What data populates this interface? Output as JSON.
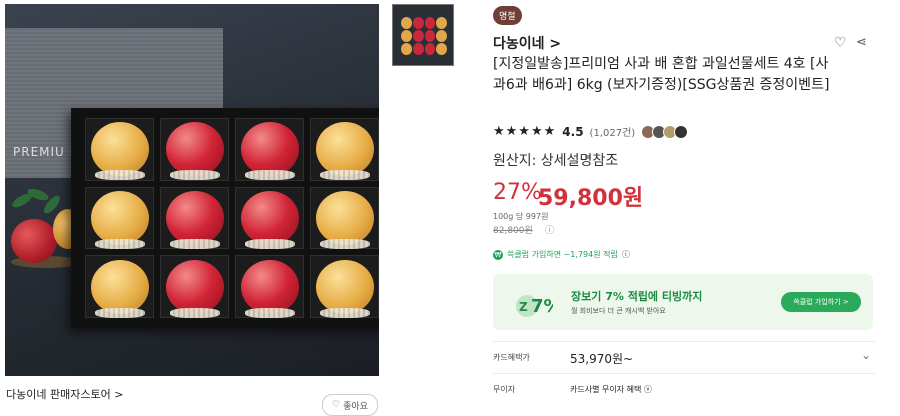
{
  "header": {
    "badge": "명절",
    "brand": "다농이네 >"
  },
  "image": {
    "panel_text": "PREMIU M"
  },
  "product": {
    "title": "[지정일발송]프리미엄 사과 배 혼합 과일선물세트 4호 [사과6과 배6과] 6kg (보자기증정)[SSG상품권 증정이벤트]",
    "stars": "★★★★★",
    "rating": "4.5",
    "review_count": "(1,027건)",
    "origin": "원산지: 상세설명참조"
  },
  "price": {
    "discount": "27%",
    "sale": "59,800원",
    "unit": "100g 당 997원",
    "original": "82,800원"
  },
  "membership": {
    "text": "쓱클럽 가입하면 ~1,794원 적립"
  },
  "banner": {
    "title": "장보기 7% 적립에 티빙까지",
    "subtitle": "월 회비보다 더 큰 캐시백 받아요",
    "button": "쓱클럽 가입하기 >"
  },
  "rows": [
    {
      "label": "카드혜택가",
      "value": "53,970원~"
    },
    {
      "label": "무이자",
      "value": "카드사별 무이자 혜택"
    }
  ],
  "footer": {
    "store": "다농이네 판매자스토어 >",
    "like": "좋아요"
  },
  "colors": {
    "accent_red": "#d1313a",
    "green": "#18a055",
    "badge": "#6d3f35"
  },
  "icons": [
    "heart-icon",
    "share-icon",
    "chevron-down-icon",
    "info-icon",
    "star-icon"
  ]
}
